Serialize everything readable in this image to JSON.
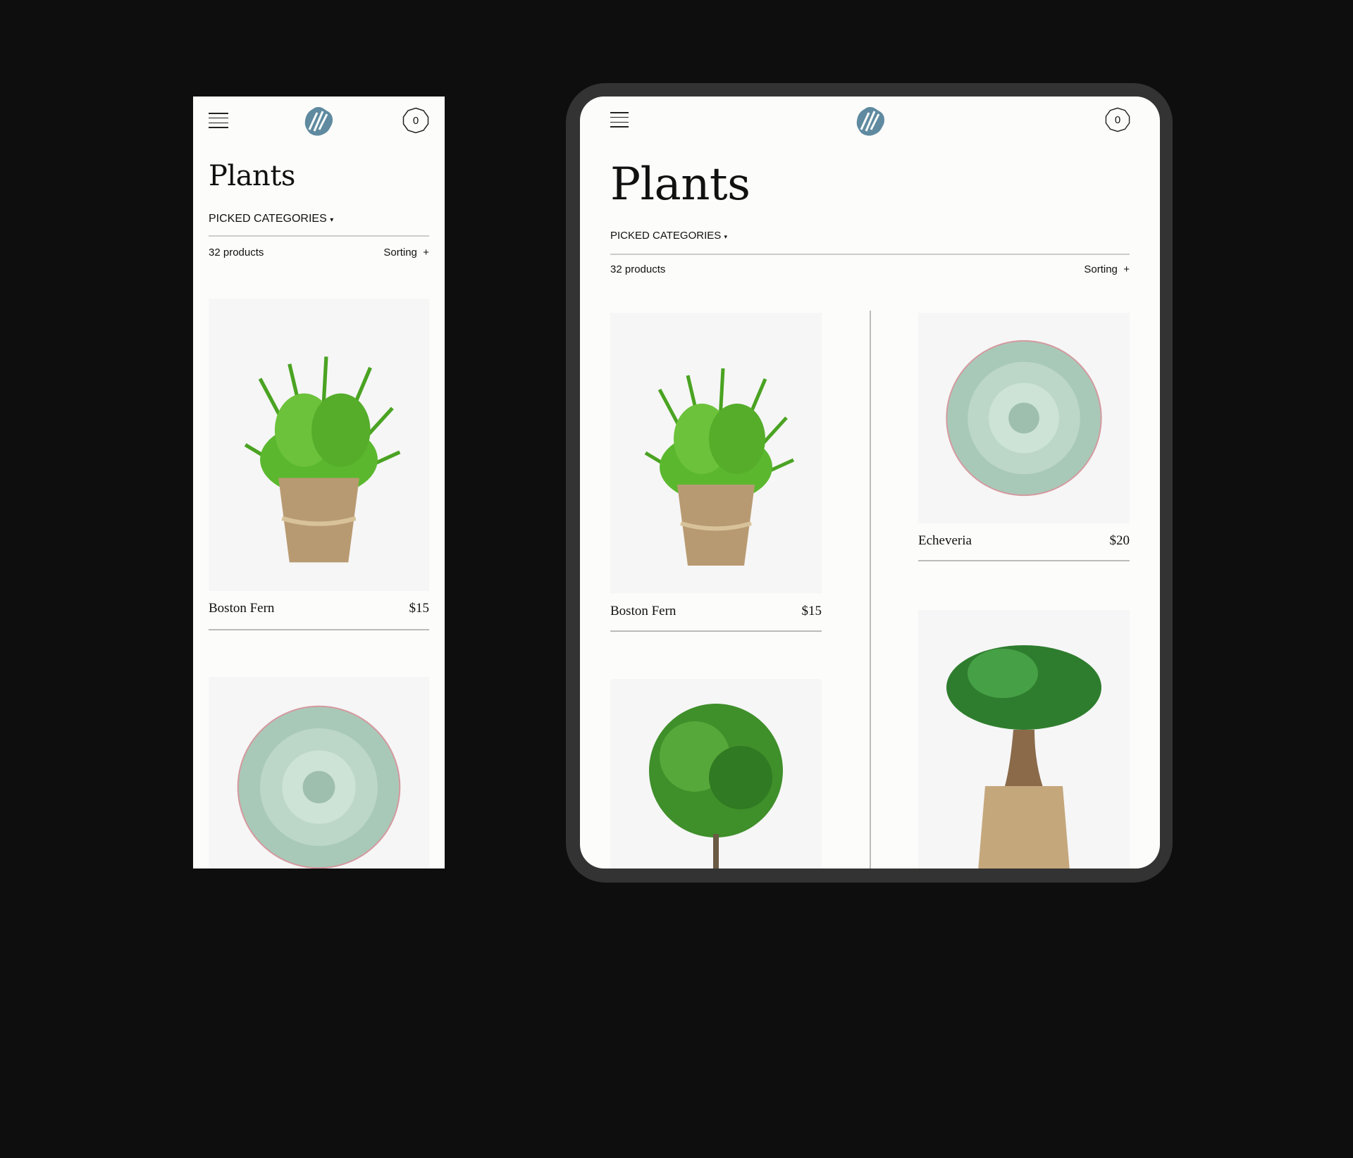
{
  "brand": {
    "logo_color": "#5f8aa0"
  },
  "page": {
    "title": "Plants",
    "filter_label": "PICKED CATEGORIES",
    "filter_caret": "▾",
    "count": "32 products",
    "sorting_label": "Sorting",
    "sorting_icon": "+"
  },
  "cart": {
    "count": "0"
  },
  "products": [
    {
      "name": "Boston Fern",
      "price": "$15",
      "image": "fern"
    },
    {
      "name": "Echeveria",
      "price": "$20",
      "image": "succulent"
    },
    {
      "name": "",
      "price": "",
      "image": "shrub"
    },
    {
      "name": "",
      "price": "",
      "image": "ficus"
    }
  ],
  "colors": {
    "background": "#0e0e0e",
    "screen": "#fcfcfa",
    "tablet_bezel": "#333333"
  }
}
